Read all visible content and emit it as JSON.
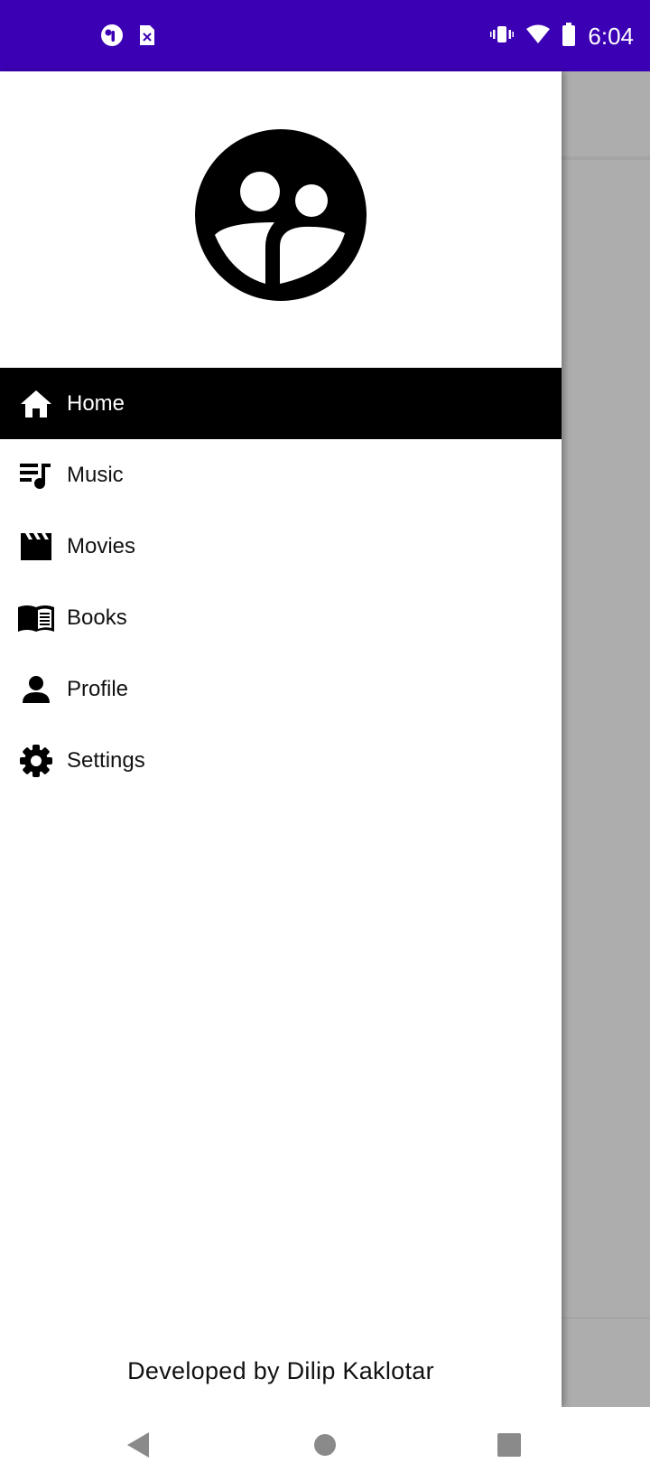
{
  "status_bar": {
    "time": "6:04",
    "left_icons": [
      "app-notification-icon",
      "sim-card-icon"
    ],
    "right_icons": [
      "vibrate-icon",
      "wifi-icon",
      "battery-icon"
    ],
    "background": "#3c00b4"
  },
  "drawer": {
    "avatar_icon": "group-avatar-icon",
    "menu": [
      {
        "label": "Home",
        "icon": "home-icon",
        "active": true
      },
      {
        "label": "Music",
        "icon": "queue-music-icon",
        "active": false
      },
      {
        "label": "Movies",
        "icon": "movie-clapper-icon",
        "active": false
      },
      {
        "label": "Books",
        "icon": "book-icon",
        "active": false
      },
      {
        "label": "Profile",
        "icon": "person-icon",
        "active": false
      },
      {
        "label": "Settings",
        "icon": "gear-icon",
        "active": false
      }
    ],
    "footer": "Developed by Dilip Kaklotar"
  },
  "nav_bar": {
    "buttons": [
      "back-icon",
      "home-circle-icon",
      "recents-icon"
    ]
  }
}
